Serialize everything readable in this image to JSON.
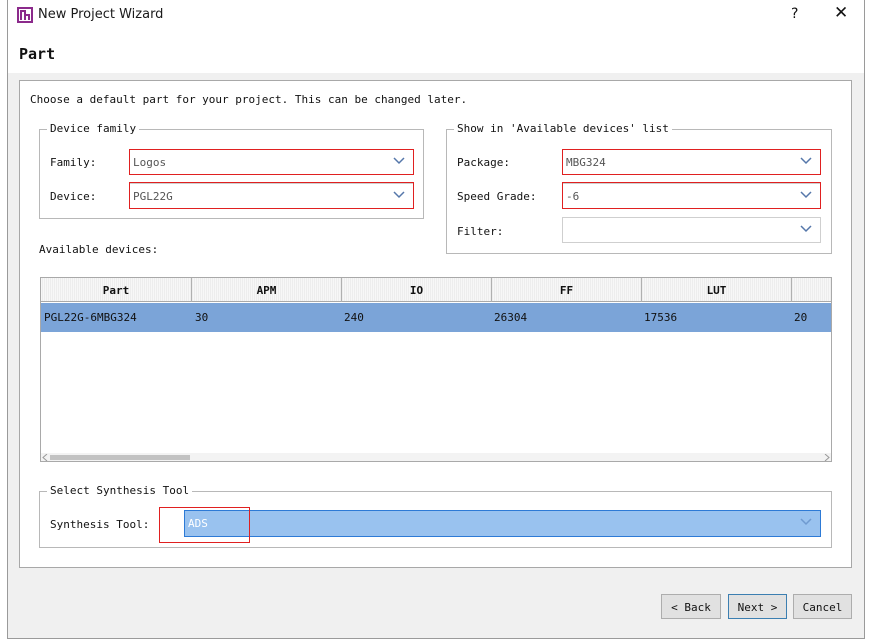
{
  "window": {
    "title": "New Project Wizard",
    "help_label": "?",
    "close_label": "✕"
  },
  "page": {
    "title": "Part",
    "instruction": "Choose a default part for your project. This can be changed later."
  },
  "device_family": {
    "legend": "Device family",
    "family_label": "Family:",
    "family_value": "Logos",
    "device_label": "Device:",
    "device_value": "PGL22G"
  },
  "available_filter": {
    "legend": "Show in 'Available devices' list",
    "package_label": "Package:",
    "package_value": "MBG324",
    "speed_label": "Speed Grade:",
    "speed_value": "-6",
    "filter_label": "Filter:",
    "filter_value": ""
  },
  "devices": {
    "label": "Available devices:",
    "columns": [
      "Part",
      "APM",
      "IO",
      "FF",
      "LUT",
      ""
    ],
    "rows": [
      [
        "PGL22G-6MBG324",
        "30",
        "240",
        "26304",
        "17536",
        "20"
      ]
    ]
  },
  "synthesis": {
    "legend": "Select Synthesis Tool",
    "tool_label": "Synthesis Tool:",
    "tool_value": "ADS"
  },
  "buttons": {
    "back": "< Back",
    "next": "Next >",
    "cancel": "Cancel"
  },
  "colors": {
    "selected_row": "#7ba4d8",
    "synthesis_combo": "#99c2ef",
    "highlight_box": "#e02020",
    "logo": "#8b2a8b"
  },
  "icons": {
    "logo": "app-logo-icon",
    "dropdown": "chevron-down-icon"
  }
}
